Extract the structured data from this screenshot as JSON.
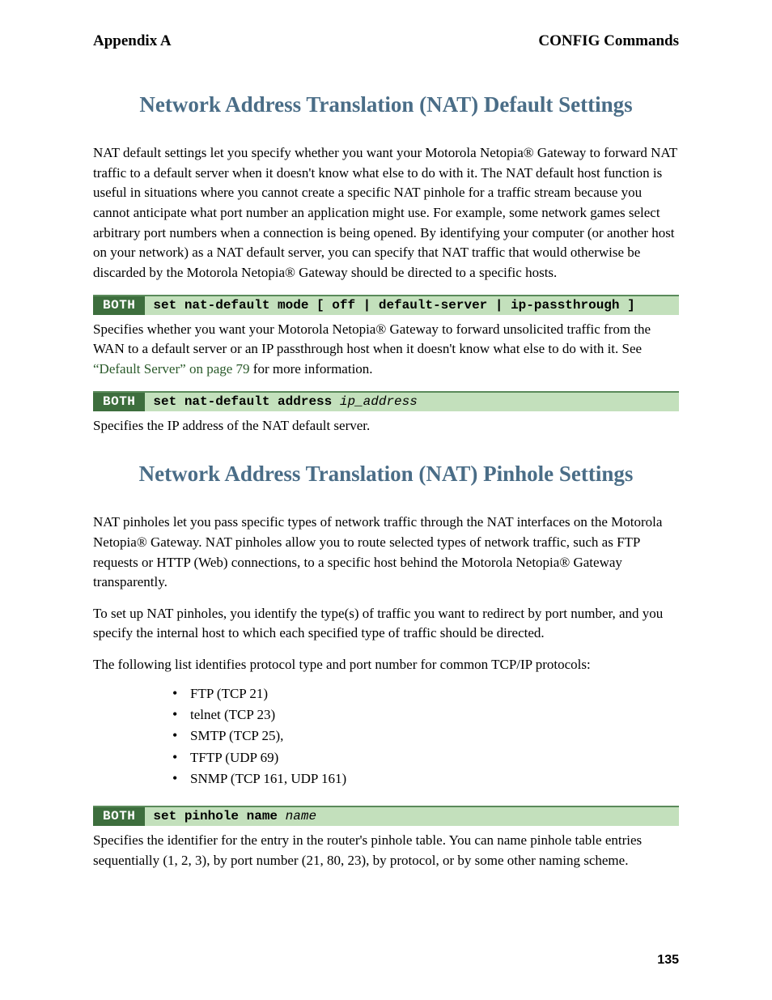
{
  "header": {
    "left": "Appendix A",
    "right": "CONFIG Commands"
  },
  "sections": {
    "default": {
      "title": "Network Address Translation (NAT) Default Settings",
      "intro1": "NAT default settings let you specify whether you want your Motorola Netopia® Gateway to forward NAT traffic to a default server when it doesn't know what else to do with it. The NAT default host function is useful in situations where you cannot create a specific NAT pinhole for a traffic stream because you cannot anticipate what port number an application might use. For example, some network games select arbitrary port numbers when a connection is being opened. By identifying your computer (or another host on your network) as a NAT default server, you can specify that NAT traffic that would otherwise be discarded by the Motorola Netopia® Gateway should be directed to a specific hosts.",
      "cmd1": {
        "label": "BOTH",
        "command": "set nat-default mode [ off | default-server | ip-passthrough ]",
        "desc_prefix": "Specifies whether you want your Motorola Netopia® Gateway to forward unsolicited traffic from the WAN to a default server or an IP passthrough host when it doesn't know what else to do with it. See ",
        "desc_link": "“Default Server”",
        "desc_pageref": " on page 79",
        "desc_suffix": " for more information."
      },
      "cmd2": {
        "label": "BOTH",
        "command": "set nat-default address ",
        "command_arg": "ip_address",
        "desc": "Specifies the IP address of the NAT default server."
      }
    },
    "pinhole": {
      "title": "Network Address Translation (NAT) Pinhole Settings",
      "intro1": "NAT pinholes let you pass specific types of network traffic through the NAT interfaces on the Motorola Netopia® Gateway. NAT pinholes allow you to route selected types of network traffic, such as FTP requests or HTTP (Web) connections, to a specific host behind the Motorola Netopia® Gateway transparently.",
      "intro2": "To set up NAT pinholes, you identify the type(s) of traffic you want to redirect by port number, and you specify the internal host to which each specified type of traffic should be directed.",
      "intro3": "The following list identifies protocol type and port number for common TCP/IP protocols:",
      "list": [
        "FTP (TCP 21)",
        "telnet (TCP 23)",
        "SMTP (TCP 25),",
        "TFTP (UDP 69)",
        "SNMP (TCP 161, UDP 161)"
      ],
      "cmd1": {
        "label": "BOTH",
        "command": "set pinhole name ",
        "command_arg": "name",
        "desc": "Specifies the identifier for the entry in the router's pinhole table. You can name pinhole table entries sequentially (1, 2, 3), by port number (21, 80, 23), by protocol, or by some other naming scheme."
      }
    }
  },
  "footer": {
    "page_number": "135"
  }
}
